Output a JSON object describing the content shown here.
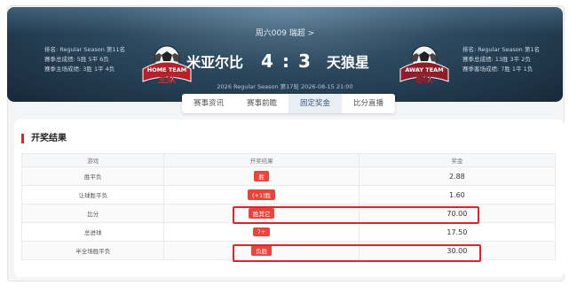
{
  "header": {
    "round_link": "周六009 瑞超 >",
    "home": {
      "name": "米亚尔比",
      "rank": "排名: Regular Season 第11名",
      "season_record": "赛季总成绩: 5胜 5平 6负",
      "home_record": "赛季主场成绩: 3胜 1平 4负",
      "badge_line1": "HOME TEAM",
      "badge_line2": "主队"
    },
    "away": {
      "name": "天狼星",
      "rank": "排名: Regular Season 第1名",
      "season_record": "赛季总成绩: 13胜 3平 2负",
      "away_record": "赛季客场成绩: 7胜 1平 1负",
      "badge_line1": "AWAY TEAM",
      "badge_line2": "客队"
    },
    "score_home": "4",
    "score_sep": ":",
    "score_away": "3",
    "meta": "2026 Regular Season 第17轮  2026-08-15 21:00"
  },
  "tabs": [
    {
      "label": "赛事资讯",
      "active": false
    },
    {
      "label": "赛事前瞻",
      "active": false
    },
    {
      "label": "固定奖金",
      "active": true
    },
    {
      "label": "比分直播",
      "active": false
    }
  ],
  "results": {
    "title": "开奖结果",
    "columns": [
      "游戏",
      "开奖结果",
      "奖金"
    ],
    "rows": [
      {
        "game": "胜平负",
        "result": "胜",
        "prize": "2.88"
      },
      {
        "game": "让球胜平负",
        "result": "(+1)胜",
        "prize": "1.60"
      },
      {
        "game": "比分",
        "result": "胜其它",
        "prize": "70.00"
      },
      {
        "game": "总进球",
        "result": "7+",
        "prize": "17.50"
      },
      {
        "game": "半全场胜平负",
        "result": "负胜",
        "prize": "30.00"
      }
    ]
  },
  "colors": {
    "accent_red": "#e8453c",
    "highlight_red": "#e0242d",
    "hero_dark": "#17293a",
    "hero_mid": "#2d4a60"
  }
}
